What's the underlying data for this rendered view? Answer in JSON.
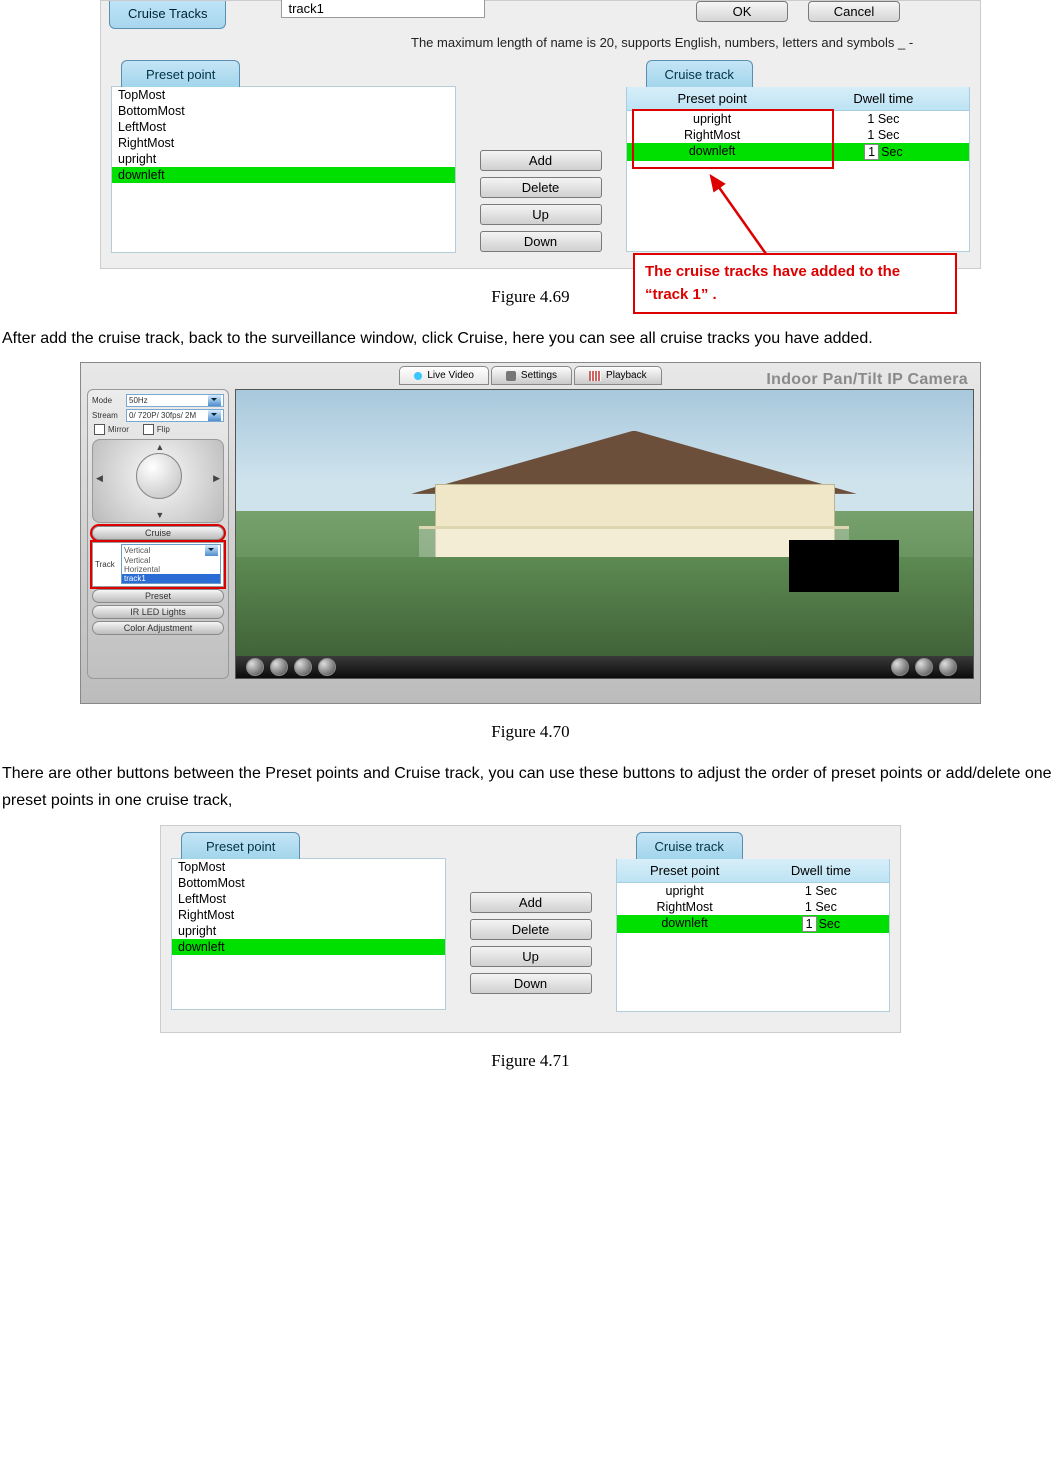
{
  "fig469": {
    "tab_cruise_tracks": "Cruise Tracks",
    "track_input": "track1",
    "btn_ok": "OK",
    "btn_cancel": "Cancel",
    "hint": "The maximum length of name is 20, supports English, numbers, letters and symbols _ -",
    "preset_tab": "Preset point",
    "presets": [
      "TopMost",
      "BottomMost",
      "LeftMost",
      "RightMost",
      "upright",
      "downleft"
    ],
    "mid_add": "Add",
    "mid_delete": "Delete",
    "mid_up": "Up",
    "mid_down": "Down",
    "cruise_tab": "Cruise track",
    "th_pp": "Preset point",
    "th_dt": "Dwell time",
    "rows": [
      {
        "pp": "upright",
        "dt": "1 Sec"
      },
      {
        "pp": "RightMost",
        "dt": "1 Sec"
      },
      {
        "pp": "downleft",
        "dt_num": "1",
        "dt_unit": "Sec"
      }
    ],
    "callout": "The cruise tracks have added to the “track 1” .",
    "caption": "Figure 4.69"
  },
  "para1": "After add the cruise track, back to the surveillance window, click Cruise, here you can see all cruise tracks you have added.",
  "fig470": {
    "tabs": {
      "live": "Live Video",
      "settings": "Settings",
      "playback": "Playback"
    },
    "brand": "Indoor Pan/Tilt IP Camera",
    "mode_lbl": "Mode",
    "mode_val": "50Hz",
    "stream_lbl": "Stream",
    "stream_val": "0/ 720P/ 30fps/ 2M",
    "mirror": "Mirror",
    "flip": "Flip",
    "cruise_btn": "Cruise",
    "track_lbl": "Track",
    "track_opts": [
      "Vertical",
      "Vertical",
      "Horizental",
      "track1"
    ],
    "preset_btn": "Preset",
    "ir_btn": "IR LED Lights",
    "color_btn": "Color Adjustment",
    "caption": "Figure 4.70"
  },
  "para2": "There are other buttons between the Preset points and Cruise track, you can use these buttons to adjust the order of preset points or add/delete one preset points in one cruise track,",
  "fig471": {
    "preset_tab": "Preset point",
    "presets": [
      "TopMost",
      "BottomMost",
      "LeftMost",
      "RightMost",
      "upright",
      "downleft"
    ],
    "mid_add": "Add",
    "mid_delete": "Delete",
    "mid_up": "Up",
    "mid_down": "Down",
    "cruise_tab": "Cruise track",
    "th_pp": "Preset point",
    "th_dt": "Dwell time",
    "rows": [
      {
        "pp": "upright",
        "dt": "1 Sec"
      },
      {
        "pp": "RightMost",
        "dt": "1 Sec"
      },
      {
        "pp": "downleft",
        "dt_num": "1",
        "dt_unit": "Sec"
      }
    ],
    "caption": "Figure 4.71"
  }
}
